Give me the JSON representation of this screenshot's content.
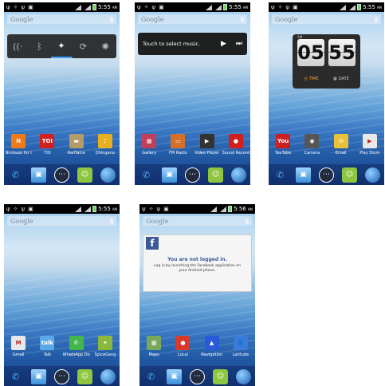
{
  "statusbar": {
    "p1": "5:55",
    "p2": "5:55",
    "p3": "5:55",
    "p4": "5:55",
    "p5": "5:56",
    "ampm": "AM"
  },
  "search": {
    "brand": "Google"
  },
  "music": {
    "label": "Touch to select music.",
    "play": "▶",
    "next": "⏭"
  },
  "clock": {
    "hour": "05",
    "minute": "55",
    "ampm": "AM",
    "time_label": "TIME",
    "date_label": "DATE"
  },
  "facebook": {
    "logo": "f",
    "title": "You are not logged in.",
    "message": "Log in by launching the Facebook application on your Android phone."
  },
  "screen1": {
    "apps": [
      {
        "label": "Nimbuzz for I",
        "glyph": "N",
        "color": "#f07a1a"
      },
      {
        "label": "TOI",
        "glyph": "TOI",
        "color": "#d22020"
      },
      {
        "label": "RailYatra",
        "glyph": "▬",
        "color": "#b59a6a"
      },
      {
        "label": "Dhingana",
        "glyph": "♪",
        "color": "#e8b020"
      }
    ]
  },
  "screen2": {
    "apps": [
      {
        "label": "Gallery",
        "glyph": "▦",
        "color": "#c0405a"
      },
      {
        "label": "FM Radio",
        "glyph": "▭",
        "color": "#d4702a"
      },
      {
        "label": "Video Player",
        "glyph": "▶",
        "color": "#333333"
      },
      {
        "label": "Sound Record",
        "glyph": "●",
        "color": "#d02020"
      }
    ]
  },
  "screen3": {
    "apps": [
      {
        "label": "YouTube",
        "glyph": "You",
        "color": "#cc2020"
      },
      {
        "label": "Camera",
        "glyph": "◉",
        "color": "#555555"
      },
      {
        "label": "Email",
        "glyph": "✉",
        "color": "#e8c23a"
      },
      {
        "label": "Play Store",
        "glyph": "▶",
        "color": "#e8e8e8"
      }
    ]
  },
  "screen4": {
    "apps": [
      {
        "label": "Gmail",
        "glyph": "M",
        "color": "#e8e8e8"
      },
      {
        "label": "Talk",
        "glyph": "talk",
        "color": "#5aa8e8"
      },
      {
        "label": "WhatsApp Do",
        "glyph": "✆",
        "color": "#43b64a"
      },
      {
        "label": "SpiceGang",
        "glyph": "✦",
        "color": "#8ab83a"
      }
    ]
  },
  "screen5": {
    "apps": [
      {
        "label": "Maps",
        "glyph": "▦",
        "color": "#7aa85a"
      },
      {
        "label": "Local",
        "glyph": "●",
        "color": "#d83a2a"
      },
      {
        "label": "Navigation",
        "glyph": "▲",
        "color": "#2a5ad8"
      },
      {
        "label": "Latitude",
        "glyph": "👤",
        "color": "#3a7ad8"
      }
    ]
  },
  "colors": {
    "accent": "#3da4ff",
    "facebook": "#3b5998",
    "clock_accent": "#f3a233"
  }
}
